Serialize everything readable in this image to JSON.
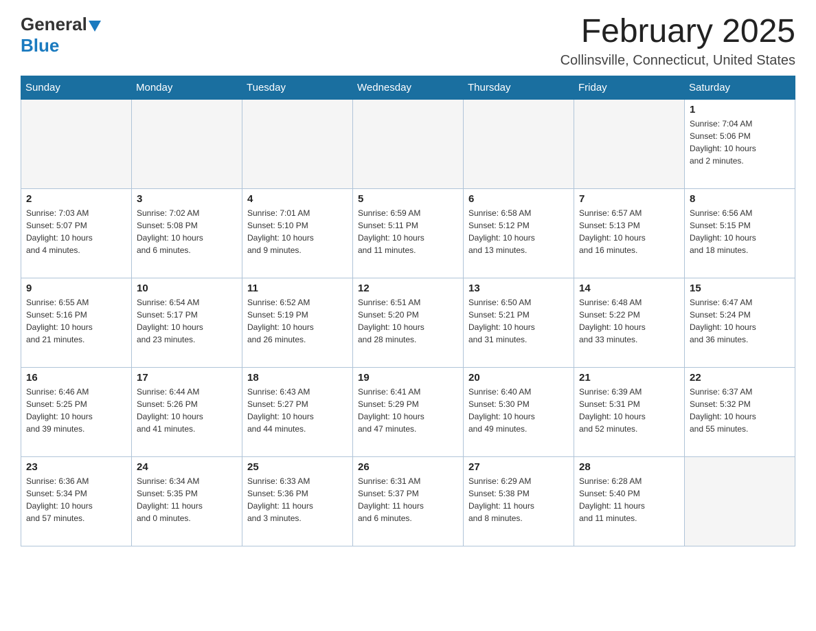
{
  "header": {
    "logo_general": "General",
    "logo_blue": "Blue",
    "title": "February 2025",
    "location": "Collinsville, Connecticut, United States"
  },
  "days_of_week": [
    "Sunday",
    "Monday",
    "Tuesday",
    "Wednesday",
    "Thursday",
    "Friday",
    "Saturday"
  ],
  "weeks": [
    [
      {
        "day": "",
        "info": "",
        "empty": true
      },
      {
        "day": "",
        "info": "",
        "empty": true
      },
      {
        "day": "",
        "info": "",
        "empty": true
      },
      {
        "day": "",
        "info": "",
        "empty": true
      },
      {
        "day": "",
        "info": "",
        "empty": true
      },
      {
        "day": "",
        "info": "",
        "empty": true
      },
      {
        "day": "1",
        "info": "Sunrise: 7:04 AM\nSunset: 5:06 PM\nDaylight: 10 hours\nand 2 minutes."
      }
    ],
    [
      {
        "day": "2",
        "info": "Sunrise: 7:03 AM\nSunset: 5:07 PM\nDaylight: 10 hours\nand 4 minutes."
      },
      {
        "day": "3",
        "info": "Sunrise: 7:02 AM\nSunset: 5:08 PM\nDaylight: 10 hours\nand 6 minutes."
      },
      {
        "day": "4",
        "info": "Sunrise: 7:01 AM\nSunset: 5:10 PM\nDaylight: 10 hours\nand 9 minutes."
      },
      {
        "day": "5",
        "info": "Sunrise: 6:59 AM\nSunset: 5:11 PM\nDaylight: 10 hours\nand 11 minutes."
      },
      {
        "day": "6",
        "info": "Sunrise: 6:58 AM\nSunset: 5:12 PM\nDaylight: 10 hours\nand 13 minutes."
      },
      {
        "day": "7",
        "info": "Sunrise: 6:57 AM\nSunset: 5:13 PM\nDaylight: 10 hours\nand 16 minutes."
      },
      {
        "day": "8",
        "info": "Sunrise: 6:56 AM\nSunset: 5:15 PM\nDaylight: 10 hours\nand 18 minutes."
      }
    ],
    [
      {
        "day": "9",
        "info": "Sunrise: 6:55 AM\nSunset: 5:16 PM\nDaylight: 10 hours\nand 21 minutes."
      },
      {
        "day": "10",
        "info": "Sunrise: 6:54 AM\nSunset: 5:17 PM\nDaylight: 10 hours\nand 23 minutes."
      },
      {
        "day": "11",
        "info": "Sunrise: 6:52 AM\nSunset: 5:19 PM\nDaylight: 10 hours\nand 26 minutes."
      },
      {
        "day": "12",
        "info": "Sunrise: 6:51 AM\nSunset: 5:20 PM\nDaylight: 10 hours\nand 28 minutes."
      },
      {
        "day": "13",
        "info": "Sunrise: 6:50 AM\nSunset: 5:21 PM\nDaylight: 10 hours\nand 31 minutes."
      },
      {
        "day": "14",
        "info": "Sunrise: 6:48 AM\nSunset: 5:22 PM\nDaylight: 10 hours\nand 33 minutes."
      },
      {
        "day": "15",
        "info": "Sunrise: 6:47 AM\nSunset: 5:24 PM\nDaylight: 10 hours\nand 36 minutes."
      }
    ],
    [
      {
        "day": "16",
        "info": "Sunrise: 6:46 AM\nSunset: 5:25 PM\nDaylight: 10 hours\nand 39 minutes."
      },
      {
        "day": "17",
        "info": "Sunrise: 6:44 AM\nSunset: 5:26 PM\nDaylight: 10 hours\nand 41 minutes."
      },
      {
        "day": "18",
        "info": "Sunrise: 6:43 AM\nSunset: 5:27 PM\nDaylight: 10 hours\nand 44 minutes."
      },
      {
        "day": "19",
        "info": "Sunrise: 6:41 AM\nSunset: 5:29 PM\nDaylight: 10 hours\nand 47 minutes."
      },
      {
        "day": "20",
        "info": "Sunrise: 6:40 AM\nSunset: 5:30 PM\nDaylight: 10 hours\nand 49 minutes."
      },
      {
        "day": "21",
        "info": "Sunrise: 6:39 AM\nSunset: 5:31 PM\nDaylight: 10 hours\nand 52 minutes."
      },
      {
        "day": "22",
        "info": "Sunrise: 6:37 AM\nSunset: 5:32 PM\nDaylight: 10 hours\nand 55 minutes."
      }
    ],
    [
      {
        "day": "23",
        "info": "Sunrise: 6:36 AM\nSunset: 5:34 PM\nDaylight: 10 hours\nand 57 minutes."
      },
      {
        "day": "24",
        "info": "Sunrise: 6:34 AM\nSunset: 5:35 PM\nDaylight: 11 hours\nand 0 minutes."
      },
      {
        "day": "25",
        "info": "Sunrise: 6:33 AM\nSunset: 5:36 PM\nDaylight: 11 hours\nand 3 minutes."
      },
      {
        "day": "26",
        "info": "Sunrise: 6:31 AM\nSunset: 5:37 PM\nDaylight: 11 hours\nand 6 minutes."
      },
      {
        "day": "27",
        "info": "Sunrise: 6:29 AM\nSunset: 5:38 PM\nDaylight: 11 hours\nand 8 minutes."
      },
      {
        "day": "28",
        "info": "Sunrise: 6:28 AM\nSunset: 5:40 PM\nDaylight: 11 hours\nand 11 minutes."
      },
      {
        "day": "",
        "info": "",
        "empty": true
      }
    ]
  ]
}
